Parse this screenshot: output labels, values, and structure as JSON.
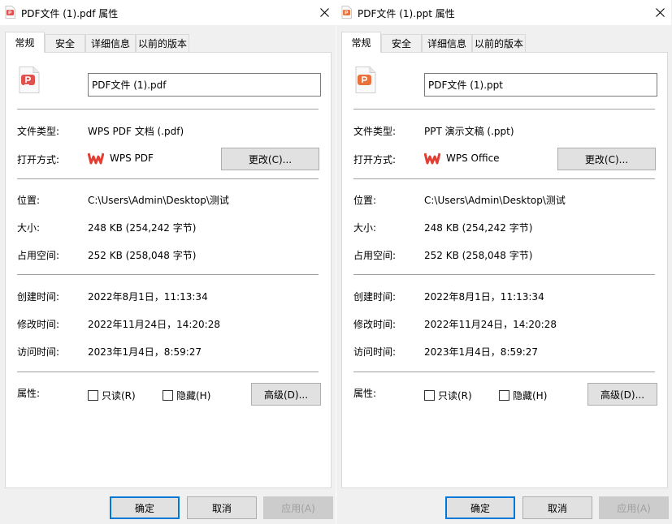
{
  "dialogs": [
    {
      "title": "PDF文件 (1).pdf 属性",
      "title_icon": "pdf-file-icon",
      "tabs": [
        {
          "label": "常规",
          "active": true
        },
        {
          "label": "安全",
          "active": false
        },
        {
          "label": "详细信息",
          "active": false
        },
        {
          "label": "以前的版本",
          "active": false
        }
      ],
      "filename": "PDF文件 (1).pdf",
      "file_icon": "pdf-file-icon",
      "type_label": "文件类型:",
      "type_value": "WPS PDF 文档 (.pdf)",
      "opens_label": "打开方式:",
      "opens_app": "WPS PDF",
      "change_button": "更改(C)...",
      "location_label": "位置:",
      "location_value": "C:\\Users\\Admin\\Desktop\\测试",
      "size_label": "大小:",
      "size_value": "248 KB (254,242 字节)",
      "disk_label": "占用空间:",
      "disk_value": "252 KB (258,048 字节)",
      "created_label": "创建时间:",
      "created_value": "2022年8月1日，11:13:34",
      "modified_label": "修改时间:",
      "modified_value": "2022年11月24日，14:20:28",
      "accessed_label": "访问时间:",
      "accessed_value": "2023年1月4日，8:59:27",
      "attributes_label": "属性:",
      "readonly_label": "只读(R)",
      "hidden_label": "隐藏(H)",
      "advanced_button": "高级(D)...",
      "ok_button": "确定",
      "cancel_button": "取消",
      "apply_button": "应用(A)"
    },
    {
      "title": "PDF文件 (1).ppt 属性",
      "title_icon": "ppt-file-icon",
      "tabs": [
        {
          "label": "常规",
          "active": true
        },
        {
          "label": "安全",
          "active": false
        },
        {
          "label": "详细信息",
          "active": false
        },
        {
          "label": "以前的版本",
          "active": false
        }
      ],
      "filename": "PDF文件 (1).ppt",
      "file_icon": "ppt-file-icon",
      "type_label": "文件类型:",
      "type_value": "PPT 演示文稿 (.ppt)",
      "opens_label": "打开方式:",
      "opens_app": "WPS Office",
      "change_button": "更改(C)...",
      "location_label": "位置:",
      "location_value": "C:\\Users\\Admin\\Desktop\\测试",
      "size_label": "大小:",
      "size_value": "248 KB (254,242 字节)",
      "disk_label": "占用空间:",
      "disk_value": "252 KB (258,048 字节)",
      "created_label": "创建时间:",
      "created_value": "2022年8月1日，11:13:34",
      "modified_label": "修改时间:",
      "modified_value": "2022年11月24日，14:20:28",
      "accessed_label": "访问时间:",
      "accessed_value": "2023年1月4日，8:59:27",
      "attributes_label": "属性:",
      "readonly_label": "只读(R)",
      "hidden_label": "隐藏(H)",
      "advanced_button": "高级(D)...",
      "ok_button": "确定",
      "cancel_button": "取消",
      "apply_button": "应用(A)"
    }
  ],
  "colors": {
    "pdf_red": "#e0504d",
    "ppt_orange": "#e8713c",
    "wps_red": "#e33e33",
    "accent_blue": "#0078d7"
  }
}
